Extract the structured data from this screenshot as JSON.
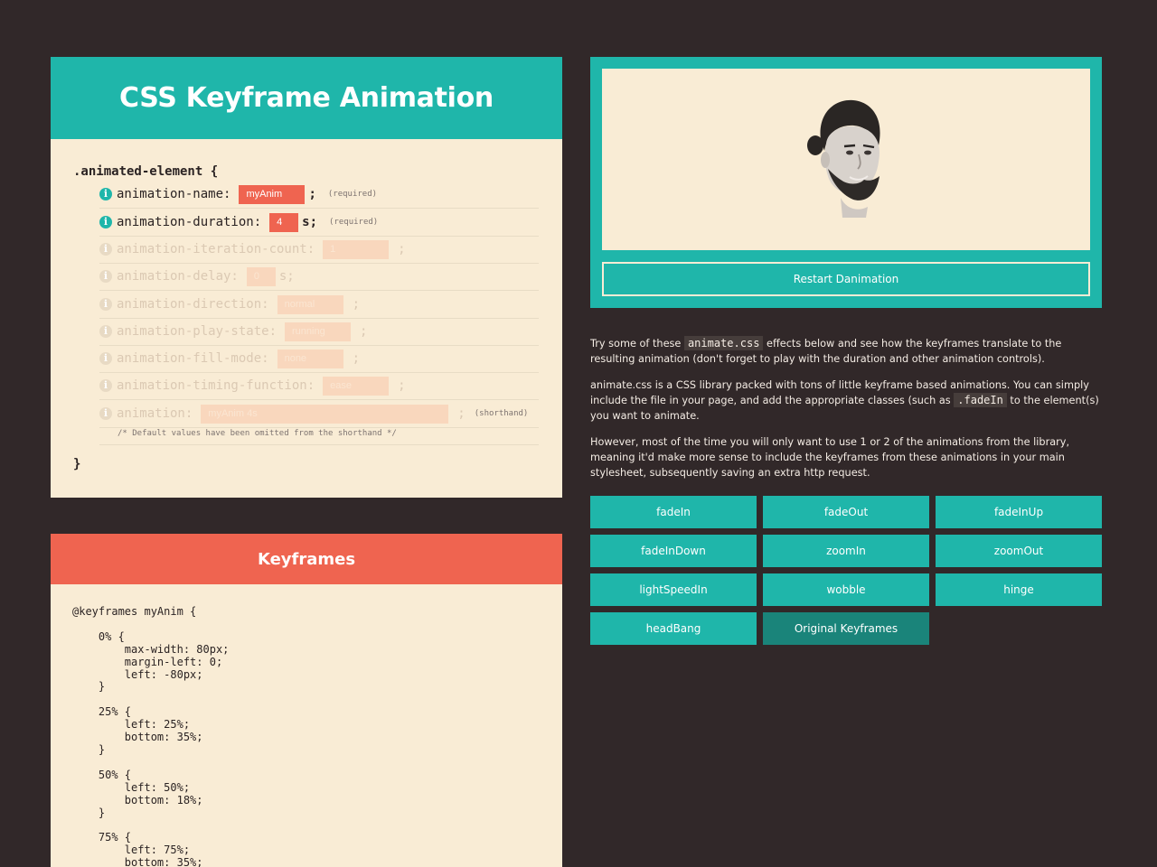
{
  "properties_panel": {
    "title": "CSS Keyframe Animation",
    "selector": ".animated-element {",
    "close_brace": "}",
    "rows": [
      {
        "name": "animation-name:",
        "value": "myAnim",
        "suffix": ";",
        "note": "(required)",
        "active": true
      },
      {
        "name": "animation-duration:",
        "value": "4",
        "suffix": "s;",
        "note": "(required)",
        "active": true
      },
      {
        "name": "animation-iteration-count:",
        "value": "1",
        "suffix": ";",
        "note": "",
        "active": false
      },
      {
        "name": "animation-delay:",
        "value": "0",
        "suffix": "s;",
        "note": "",
        "active": false
      },
      {
        "name": "animation-direction:",
        "value": "normal",
        "suffix": ";",
        "note": "",
        "active": false
      },
      {
        "name": "animation-play-state:",
        "value": "running",
        "suffix": ";",
        "note": "",
        "active": false
      },
      {
        "name": "animation-fill-mode:",
        "value": "none",
        "suffix": ";",
        "note": "",
        "active": false
      },
      {
        "name": "animation-timing-function:",
        "value": "ease",
        "suffix": ";",
        "note": "",
        "active": false
      },
      {
        "name": "animation:",
        "value": "myAnim 4s",
        "suffix": ";",
        "note": "(shorthand)",
        "active": false
      }
    ],
    "comment": "/* Default values have been omitted from the shorthand */"
  },
  "keyframes_panel": {
    "title": "Keyframes",
    "code": "@keyframes myAnim {\n\n    0% {\n        max-width: 80px;\n        margin-left: 0;\n        left: -80px;\n    }\n\n    25% {\n        left: 25%;\n        bottom: 35%;\n    }\n\n    50% {\n        left: 50%;\n        bottom: 18%;\n    }\n\n    75% {\n        left: 75%;\n        bottom: 35%;"
  },
  "stage": {
    "restart_label": "Restart Danimation"
  },
  "description": {
    "p1_before": "Try some of these ",
    "p1_code": "animate.css",
    "p1_after": " effects below and see how the keyframes translate to the resulting animation (don't forget to play with the duration and other animation controls).",
    "p2_before": "animate.css is a CSS library packed with tons of little keyframe based animations. You can simply include the file in your page, and add the appropriate classes (such as ",
    "p2_code": ".fadeIn",
    "p2_after": " to the element(s) you want to animate.",
    "p3": "However, most of the time you will only want to use 1 or 2 of the animations from the library, meaning it'd make more sense to include the keyframes from these animations in your main stylesheet, subsequently saving an extra http request."
  },
  "animation_buttons": [
    "fadeIn",
    "fadeOut",
    "fadeInUp",
    "fadeInDown",
    "zoomIn",
    "zoomOut",
    "lightSpeedIn",
    "wobble",
    "hinge",
    "headBang",
    "Original Keyframes"
  ],
  "colors": {
    "background": "#312829",
    "teal": "#1fb6aa",
    "teal_dark": "#1a847a",
    "coral": "#ef6450",
    "cream": "#f9ecd5"
  }
}
